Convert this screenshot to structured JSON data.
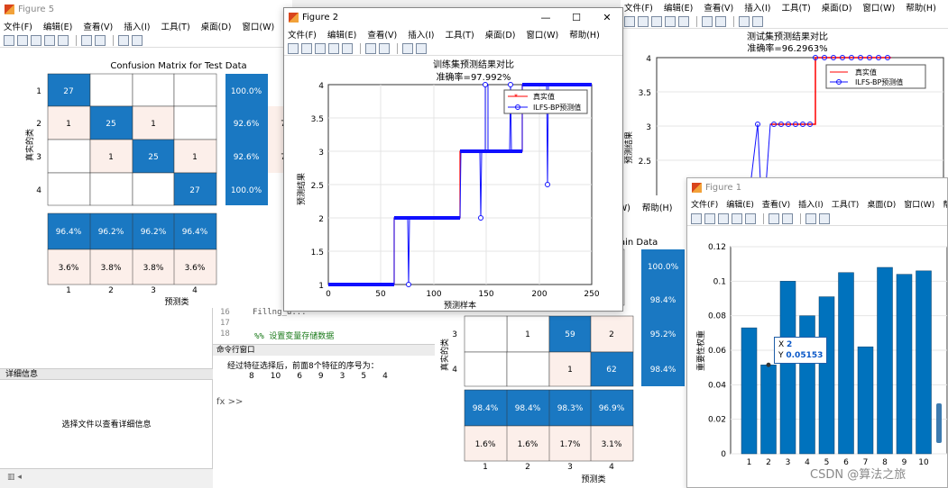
{
  "menus": [
    "文件(F)",
    "编辑(E)",
    "查看(V)",
    "插入(I)",
    "工具(T)",
    "桌面(D)",
    "窗口(W)",
    "帮助(H)"
  ],
  "figure5": {
    "title": "Figure 5",
    "chart_title": "Confusion Matrix for Test Data",
    "ylabel": "真实的类",
    "xlabel": "预测类",
    "row_labels": [
      "1",
      "2",
      "3",
      "4"
    ],
    "col_labels": [
      "1",
      "2",
      "3",
      "4"
    ],
    "matrix": [
      [
        "27",
        "",
        "",
        ""
      ],
      [
        "1",
        "25",
        "1",
        ""
      ],
      [
        "",
        "1",
        "25",
        "1"
      ],
      [
        "",
        "",
        "",
        "27"
      ]
    ],
    "row_summary": [
      "100.0%",
      "92.6%",
      "92.6%",
      "100.0%"
    ],
    "row_summary_err": [
      "",
      "7",
      "7",
      ""
    ],
    "col_summary": [
      "96.4%",
      "96.2%",
      "96.2%",
      "96.4%"
    ],
    "col_summary_err": [
      "3.6%",
      "3.8%",
      "3.8%",
      "3.6%"
    ]
  },
  "figure2": {
    "title": "Figure 2",
    "chart_title": "训练集预测结果对比",
    "subtitle": "准确率=97.992%",
    "xlabel": "预测样本",
    "ylabel": "预测结果",
    "legend_true": "真实值",
    "legend_pred": "ILFS-BP预测值",
    "xticks": [
      "0",
      "50",
      "100",
      "150",
      "200",
      "250"
    ],
    "yticks": [
      "1",
      "1.5",
      "2",
      "2.5",
      "3",
      "3.5",
      "4"
    ]
  },
  "figure_back": {
    "chart_title": "测试集预测结果对比",
    "subtitle": "准确率=96.2963%",
    "ylabel": "预测结果",
    "legend_true": "真实值",
    "legend_pred": "ILFS-BP预测值",
    "yticks": [
      "2.5",
      "3",
      "3.5",
      "4"
    ]
  },
  "figure_train_cm": {
    "title_fragment": "ain Data",
    "menu_fragment": [
      "(W)",
      "帮助(H)"
    ],
    "ylabel": "真实的类",
    "xlabel": "预测类",
    "row_labels": [
      "3",
      "4"
    ],
    "col_labels": [
      "1",
      "2",
      "3",
      "4"
    ],
    "rows": [
      [
        "",
        "1",
        "59",
        "2"
      ],
      [
        "",
        "",
        "1",
        "62"
      ]
    ],
    "row_summary": [
      "100.0%",
      "98.4%",
      "95.2%",
      "98.4%"
    ],
    "col_summary": [
      "98.4%",
      "98.4%",
      "98.3%",
      "96.9%"
    ],
    "col_summary_err": [
      "1.6%",
      "1.6%",
      "1.7%",
      "3.1%"
    ]
  },
  "figure1": {
    "title": "Figure 1",
    "xlabel": "",
    "ylabel": "重要性权重",
    "yticks": [
      "0",
      "0.02",
      "0.04",
      "0.06",
      "0.08",
      "0.1",
      "0.12"
    ],
    "datatip_x_label": "X",
    "datatip_x": "2",
    "datatip_y_label": "Y",
    "datatip_y": "0.05153"
  },
  "chart_data": {
    "type": "bar",
    "categories": [
      "1",
      "2",
      "3",
      "4",
      "5",
      "6",
      "7",
      "8",
      "9",
      "10"
    ],
    "values": [
      0.073,
      0.0515,
      0.1,
      0.08,
      0.091,
      0.105,
      0.062,
      0.108,
      0.104,
      0.106
    ],
    "ylabel": "重要性权重",
    "ylim": [
      0,
      0.12
    ],
    "grid": true,
    "color": "#0072bd"
  },
  "editor": {
    "line_numbers": [
      "16",
      "17",
      "18"
    ],
    "line16": "Fillng_u...",
    "line18_comment": "%%  设置变量存储数据"
  },
  "command_window": {
    "title": "命令行窗口",
    "output_line": "经过特征选择后，前面8个特征的序号为：",
    "numbers": [
      "8",
      "10",
      "6",
      "9",
      "3",
      "5",
      "4"
    ],
    "prompt": "fx >>"
  },
  "details_panel": {
    "header": "详细信息",
    "empty_text": "选择文件以查看详细信息"
  },
  "watermark": "CSDN @算法之旅",
  "colors": {
    "blue": "#0072bd",
    "cmBlue": "#1a78c2",
    "light": "#fcefea",
    "accentRed": "#ff0000"
  }
}
